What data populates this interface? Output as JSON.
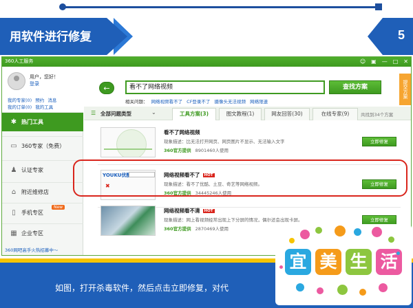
{
  "slide": {
    "title": "用软件进行修复",
    "page_number": "5",
    "caption": "如图，打开杀毒软件，然后点击立即修复，对代"
  },
  "app": {
    "title": "360人工服务",
    "titlebar_icons": [
      "user-icon",
      "shirt-icon",
      "minimize-icon",
      "maximize-icon",
      "close-icon"
    ]
  },
  "sidebar": {
    "hello": "用户，您好！",
    "login": "登录",
    "links_row1": [
      "我的专家(0)",
      "预约",
      "消息"
    ],
    "links_row2": [
      "我的订单(0)",
      "我的工具"
    ],
    "items": [
      {
        "label": "热门工具",
        "icon": "fire-icon",
        "active": true
      },
      {
        "label": "360专家（免费）",
        "icon": "monitor-icon"
      },
      {
        "label": "认证专家",
        "icon": "person-icon"
      },
      {
        "label": "附近维修店",
        "icon": "shop-icon"
      },
      {
        "label": "手机专区",
        "icon": "phone-icon",
        "badge": "New"
      },
      {
        "label": "企业专区",
        "icon": "windows-icon"
      }
    ],
    "bottom_link": "360网吧高手火热招募中～"
  },
  "main": {
    "search_value": "看不了网络视频",
    "search_button": "查找方案",
    "side_tab": "提交方案",
    "related_label": "相关问题：",
    "related_links": [
      "网络视频看不了",
      "CF登录不了",
      "摄像头无法视频",
      "网络限速"
    ],
    "filter_label": "全部问题类型",
    "tabs": [
      "工具方案(3)",
      "图文教程(1)",
      "网友回答(30)",
      "在线专家(9)"
    ],
    "result_count": "共找到34个方案",
    "results": [
      {
        "title": "看不了网络视频",
        "hot": "",
        "desc": "现象描述：比无法打开网页、网页图片不显示、无法输入文字",
        "provider": "360官方提供",
        "users": "8901460人使用",
        "button": "立即修复"
      },
      {
        "title": "网络视频看不了",
        "hot": "HOT",
        "desc": "现象描述：看不了优酷、土豆、奇艺等网络视频。",
        "provider": "360官方提供",
        "users": "34445246人使用",
        "button": "立即修复"
      },
      {
        "title": "网络视频看不清",
        "hot": "HOT",
        "desc": "现象描述：网上看视频经常出现上下分屏的情况，偶尔还会出现卡屏。",
        "provider": "360官方提供",
        "users": "2870469人使用",
        "button": "立即修复"
      }
    ],
    "thumb2_logo": "YOUKU优酷"
  },
  "sticker": {
    "chars": [
      "宜",
      "美",
      "生",
      "活"
    ],
    "colors": [
      "#2aa8e0",
      "#f59b1a",
      "#8dc63f",
      "#ec5aa0"
    ]
  }
}
